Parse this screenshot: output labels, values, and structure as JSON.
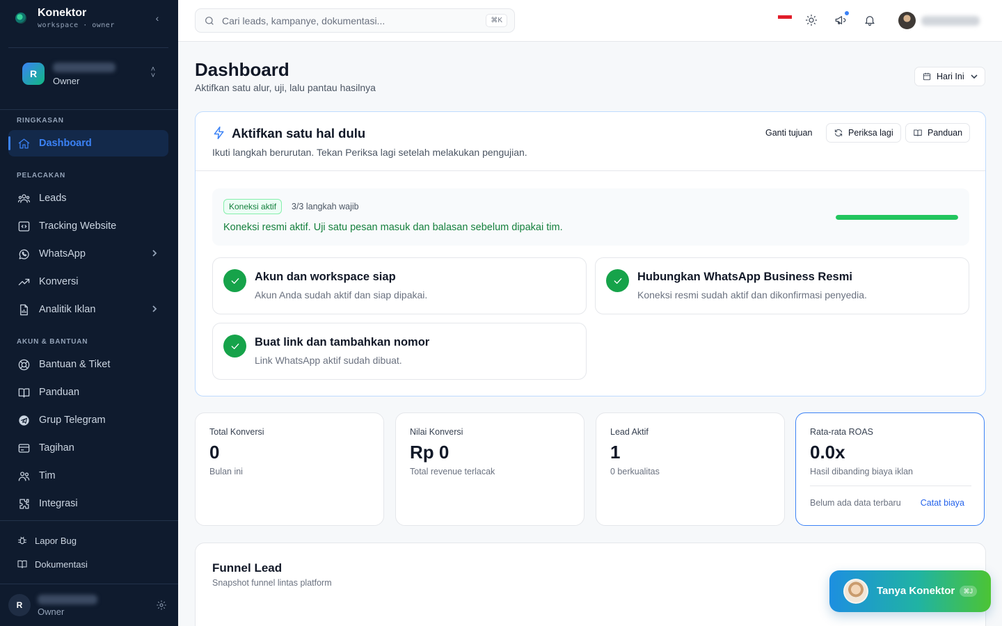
{
  "sidebar": {
    "brand_name": "Konektor",
    "brand_sub": "workspace · owner",
    "workspace": {
      "initial": "R",
      "role": "Owner"
    },
    "sections": {
      "ringkasan": "RINGKASAN",
      "pelacakan": "PELACAKAN",
      "akun": "AKUN & BANTUAN"
    },
    "items": {
      "dashboard": "Dashboard",
      "leads": "Leads",
      "tracking": "Tracking Website",
      "whatsapp": "WhatsApp",
      "konversi": "Konversi",
      "analitik": "Analitik Iklan",
      "bantuan": "Bantuan & Tiket",
      "panduan": "Panduan",
      "telegram": "Grup Telegram",
      "tagihan": "Tagihan",
      "tim": "Tim",
      "integrasi": "Integrasi",
      "lapor_bug": "Lapor Bug",
      "dokumentasi": "Dokumentasi"
    },
    "user": {
      "initial": "R",
      "role": "Owner"
    }
  },
  "topbar": {
    "search_placeholder": "Cari leads, kampanye, dokumentasi...",
    "search_kbd": "⌘K",
    "notification_dot_color": "#3b82f6"
  },
  "main": {
    "title": "Dashboard",
    "subtitle": "Aktifkan satu alur, uji, lalu pantau hasilnya",
    "date_filter": "Hari Ini"
  },
  "setup": {
    "title": "Aktifkan satu hal dulu",
    "subtitle": "Ikuti langkah berurutan. Tekan Periksa lagi setelah melakukan pengujian.",
    "change_goal": "Ganti tujuan",
    "recheck": "Periksa lagi",
    "guide": "Panduan",
    "status_pill": "Koneksi aktif",
    "steps_count": "3/3 langkah wajib",
    "status_message": "Koneksi resmi aktif. Uji satu pesan masuk dan balasan sebelum dipakai tim.",
    "progress_percent": 100,
    "steps": [
      {
        "title": "Akun dan workspace siap",
        "desc": "Akun Anda sudah aktif dan siap dipakai."
      },
      {
        "title": "Hubungkan WhatsApp Business Resmi",
        "desc": "Koneksi resmi sudah aktif dan dikonfirmasi penyedia."
      },
      {
        "title": "Buat link dan tambahkan nomor",
        "desc": "Link WhatsApp aktif sudah dibuat."
      }
    ]
  },
  "kpis": [
    {
      "label": "Total Konversi",
      "value": "0",
      "desc": "Bulan ini"
    },
    {
      "label": "Nilai Konversi",
      "value": "Rp 0",
      "desc": "Total revenue terlacak"
    },
    {
      "label": "Lead Aktif",
      "value": "1",
      "desc": "0 berkualitas"
    },
    {
      "label": "Rata-rata ROAS",
      "value": "0.0x",
      "desc": "Hasil dibanding biaya iklan",
      "foot": "Belum ada data terbaru",
      "link": "Catat biaya"
    }
  ],
  "funnel": {
    "title": "Funnel Lead",
    "subtitle": "Snapshot funnel lintas platform"
  },
  "assistant": {
    "label": "Tanya Konektor",
    "kbd": "⌘J"
  },
  "colors": {
    "accent": "#3b82f6",
    "success": "#16a34a",
    "sidebar_bg": "#0f1b2e"
  }
}
